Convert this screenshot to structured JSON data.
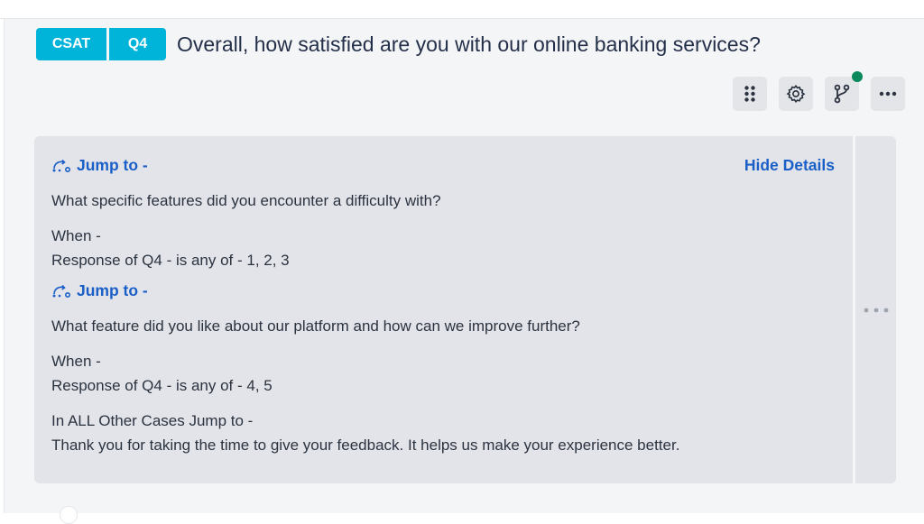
{
  "question": {
    "tag": "CSAT",
    "number": "Q4",
    "title": "Overall, how satisfied are you with our online banking services?"
  },
  "toolbar": {
    "buttons": [
      {
        "icon": "drag-handle-icon"
      },
      {
        "icon": "gear-icon"
      },
      {
        "icon": "branch-icon",
        "status_color": "#0a8a5c"
      },
      {
        "icon": "more-horizontal-icon"
      }
    ]
  },
  "details": {
    "hide_label": "Hide Details",
    "rules": [
      {
        "jump_label": "Jump to -",
        "target": "What specific features did you encounter a difficulty with?",
        "when_label": "When -",
        "condition": "Response of Q4 - is any of - 1, 2, 3"
      },
      {
        "jump_label": "Jump to -",
        "target": "What feature did you like about our platform and how can we improve further?",
        "when_label": "When -",
        "condition": "Response of Q4 - is any of - 4, 5"
      }
    ],
    "fallback_label": "In ALL Other Cases Jump to -",
    "fallback_target": "Thank you for taking the time to give your feedback. It helps us make your experience better."
  },
  "colors": {
    "accent": "#00b3d9",
    "link": "#1a5fc7",
    "panel": "#e3e4e9"
  }
}
